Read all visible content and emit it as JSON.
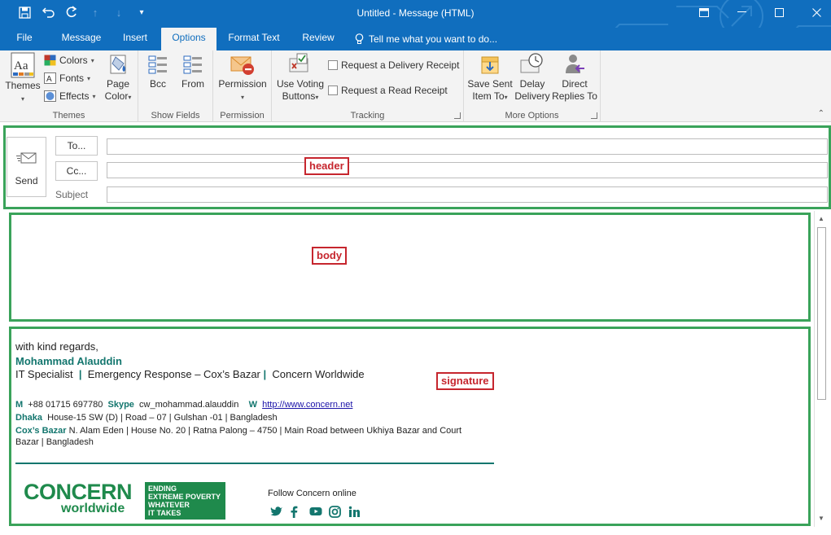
{
  "window": {
    "title": "Untitled  -  Message (HTML)"
  },
  "tabs": [
    {
      "label": "File"
    },
    {
      "label": "Message"
    },
    {
      "label": "Insert"
    },
    {
      "label": "Options",
      "active": true
    },
    {
      "label": "Format Text"
    },
    {
      "label": "Review"
    }
  ],
  "tell_me": "Tell me what you want to do...",
  "ribbon": {
    "themes": {
      "themes_label": "Themes",
      "colors_label": "Colors",
      "fonts_label": "Fonts",
      "effects_label": "Effects",
      "page_color_line1": "Page",
      "page_color_line2": "Color",
      "group_label": "Themes"
    },
    "show_fields": {
      "bcc_label": "Bcc",
      "from_label": "From",
      "group_label": "Show Fields"
    },
    "permission": {
      "permission_label": "Permission",
      "group_label": "Permission"
    },
    "tracking": {
      "voting_line1": "Use Voting",
      "voting_line2": "Buttons",
      "delivery_receipt": "Request a Delivery Receipt",
      "read_receipt": "Request a Read Receipt",
      "group_label": "Tracking"
    },
    "more_options": {
      "save_sent_line1": "Save Sent",
      "save_sent_line2": "Item To",
      "delay_line1": "Delay",
      "delay_line2": "Delivery",
      "direct_line1": "Direct",
      "direct_line2": "Replies To",
      "group_label": "More Options"
    }
  },
  "header": {
    "send_label": "Send",
    "to_label": "To...",
    "cc_label": "Cc...",
    "subject_label": "Subject",
    "to_value": "",
    "cc_value": "",
    "subject_value": ""
  },
  "annotations": {
    "header": "header",
    "body": "body",
    "signature": "signature"
  },
  "signature": {
    "greeting": "with kind regards,",
    "name": "Mohammad Alauddin",
    "role_1": "IT Specialist",
    "role_2": "Emergency Response – Cox’s Bazar",
    "role_3": "Concern Worldwide",
    "separator": "|",
    "m_label": "M",
    "phone": "+88 01715 697780",
    "skype_label": "Skype",
    "skype": "cw_mohammad.alauddin",
    "web_label": "W",
    "web": "http://www.concern.net",
    "dhaka_label": "Dhaka",
    "dhaka_address": "House-15 SW (D) |  Road – 07 | Gulshan -01 | Bangladesh",
    "cox_label": "Cox’s Bazar",
    "cox_address_1": "N. Alam Eden | House No. 20 | Ratna Palong – 4750 | Main Road between Ukhiya Bazar and Court",
    "cox_address_2": "Bazar | Bangladesh",
    "logo_line1": "CONCERN",
    "logo_line2": "worldwide",
    "tagline": [
      "ENDING",
      "EXTREME POVERTY",
      "WHATEVER",
      "IT TAKES"
    ],
    "follow_text": "Follow Concern online",
    "social_icons": [
      "twitter-icon",
      "facebook-icon",
      "youtube-icon",
      "instagram-icon",
      "linkedin-icon"
    ]
  },
  "colors": {
    "titlebar": "#106ebe",
    "ribbon": "#f3f3f3",
    "annotation_box": "#3aa35a",
    "annotation_label": "#c6262e",
    "concern_green": "#1f8a4c",
    "signature_teal": "#13766e"
  }
}
